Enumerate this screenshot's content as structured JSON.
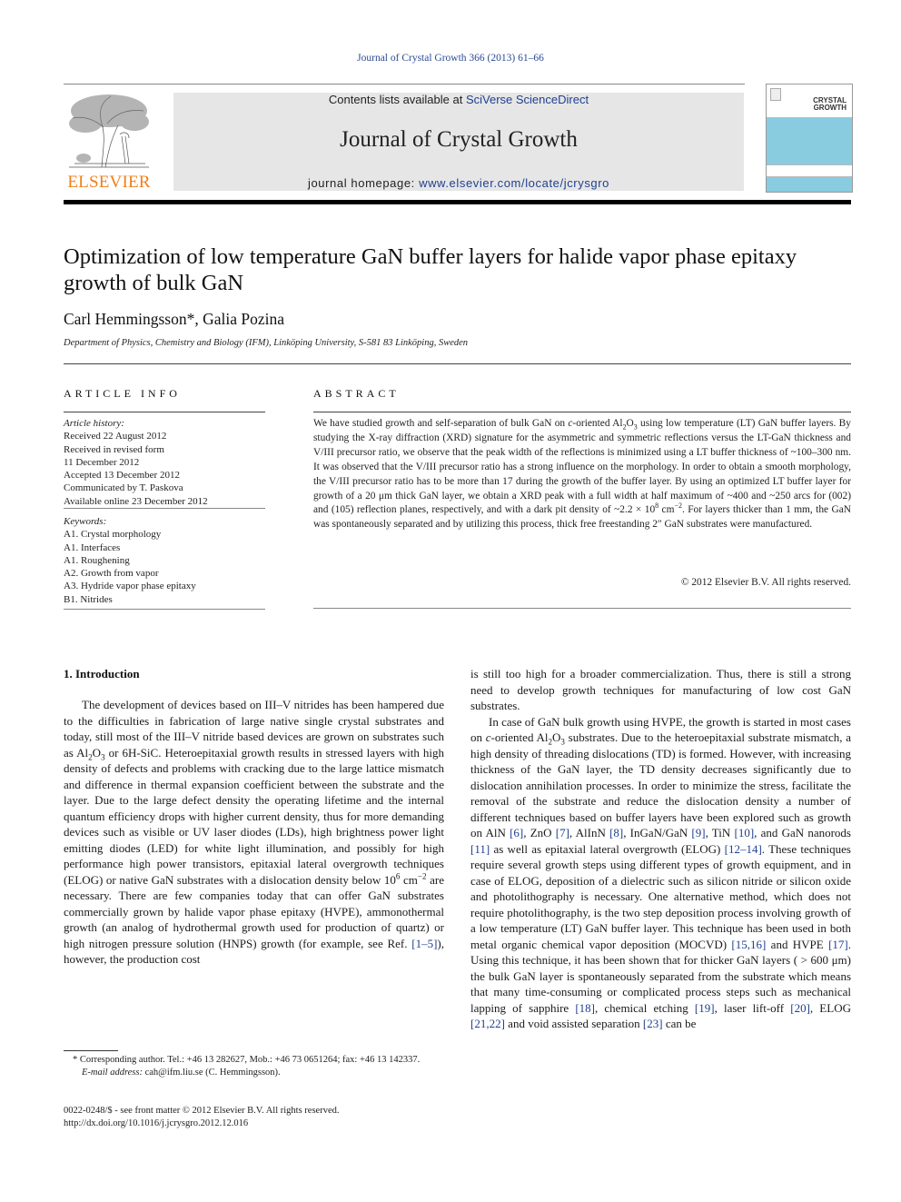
{
  "running_head": "Journal of Crystal Growth 366 (2013) 61–66",
  "header": {
    "publisher_logo_text": "ELSEVIER",
    "contents_prefix": "Contents lists available at ",
    "contents_link": "SciVerse ScienceDirect",
    "journal_name": "Journal of Crystal Growth",
    "homepage_prefix": "journal homepage: ",
    "homepage_link": "www.elsevier.com/locate/jcrysgro",
    "cover_title_line1": "CRYSTAL",
    "cover_title_line2": "GROWTH",
    "colors": {
      "link": "#1f3f8f",
      "elsevier_orange": "#f07f1b",
      "banner_bg": "#e6e6e6",
      "cover_blue": "#89cce0"
    }
  },
  "article": {
    "title": "Optimization of low temperature GaN buffer layers for halide vapor phase epitaxy growth of bulk GaN",
    "authors": "Carl Hemmingsson*, Galia Pozina",
    "affiliation": "Department of Physics, Chemistry and Biology (IFM), Linköping University, S-581 83 Linköping, Sweden"
  },
  "article_info": {
    "heading": "ARTICLE INFO",
    "history_label": "Article history:",
    "history": [
      "Received 22 August 2012",
      "Received in revised form",
      "11 December 2012",
      "Accepted 13 December 2012",
      "Communicated by T. Paskova",
      "Available online 23 December 2012"
    ],
    "keywords_label": "Keywords:",
    "keywords": [
      "A1. Crystal morphology",
      "A1. Interfaces",
      "A1. Roughening",
      "A2. Growth from vapor",
      "A3. Hydride vapor phase epitaxy",
      "B1. Nitrides"
    ]
  },
  "abstract": {
    "heading": "ABSTRACT",
    "p1": "We have studied growth and self-separation of bulk GaN on ",
    "p1_ital": "c",
    "p2": "-oriented Al",
    "sub2": "2",
    "p3": "O",
    "sub3": "3",
    "p4": " using low temperature (LT) GaN buffer layers. By studying the X-ray diffraction (XRD) signature for the asymmetric and symmetric reflections versus the LT-GaN thickness and V/III precursor ratio, we observe that the peak width of the reflections is minimized using a LT buffer thickness of ~100–300 nm. It was observed that the V/III precursor ratio has a strong influence on the morphology. In order to obtain a smooth morphology, the V/III precursor ratio has to be more than 17 during the growth of the buffer layer. By using an optimized LT buffer layer for growth of a 20 μm thick GaN layer, we obtain a XRD peak with a full width at half maximum of ~400 and ~250 arcs for (002) and (105) reflection planes, respectively, and with a dark pit density of ~2.2 × 10",
    "sup8": "8",
    "p5": " cm",
    "supm2": "−2",
    "p6": ". For layers thicker than 1 mm, the GaN was spontaneously separated and by utilizing this process, thick free freestanding 2″ GaN substrates were manufactured.",
    "copyright": "© 2012 Elsevier B.V. All rights reserved."
  },
  "introduction": {
    "heading": "1.  Introduction",
    "left": {
      "a": "The development of devices based on III–V nitrides has been hampered due to the difficulties in fabrication of large native single crystal substrates and today, still most of the III–V nitride based devices are grown on substrates such as Al",
      "b": "O",
      "c": " or 6H-SiC. Heteroepitaxial growth results in stressed layers with high density of defects and problems with cracking due to the large lattice mismatch and difference in thermal expansion coefficient between the substrate and the layer. Due to the large defect density the operating lifetime and the internal quantum efficiency drops with higher current density, thus for more demanding devices such as visible or UV laser diodes (LDs), high brightness power light emitting diodes (LED) for white light illumination, and possibly for high performance high power transistors, epitaxial lateral overgrowth techniques (ELOG) or native GaN substrates with a dislocation density below 10",
      "sup6": "6",
      "d": " cm",
      "supm2": "−2",
      "e": " are necessary. There are few companies today that can offer GaN substrates commercially grown by halide vapor phase epitaxy (HVPE), ammonothermal growth (an analog of hydrothermal growth used for production of quartz) or high nitrogen pressure solution (HNPS) growth (for example, see Ref. ",
      "ref1": "[1–5]",
      "f": "), however, the production cost"
    },
    "right": {
      "p1": "is still too high for a broader commercialization. Thus, there is still a strong need to develop growth techniques for manufacturing of low cost GaN substrates.",
      "p2a": "In case of GaN bulk growth using HVPE, the growth is started in most cases on ",
      "p2ital": "c",
      "p2b": "-oriented Al",
      "p2c": "O",
      "p2d": " substrates. Due to the heteroepitaxial substrate mismatch, a high density of threading dislocations (TD) is formed. However, with increasing thickness of the GaN layer, the TD density decreases significantly due to dislocation annihilation processes. In order to minimize the stress, facilitate the removal of the substrate and reduce the dislocation density a number of different techniques based on buffer layers have been explored such as growth on AlN ",
      "r6": "[6]",
      "t1": ", ZnO ",
      "r7": "[7]",
      "t2": ", AlInN ",
      "r8": "[8]",
      "t3": ", InGaN/GaN ",
      "r9": "[9]",
      "t4": ", TiN ",
      "r10": "[10]",
      "t5": ", and GaN nanorods ",
      "r11": "[11]",
      "t6": " as well as epitaxial lateral overgrowth (ELOG) ",
      "r12": "[12–14]",
      "t7": ". These techniques require several growth steps using different types of growth equipment, and in case of ELOG, deposition of a dielectric such as silicon nitride or silicon oxide and photolithography is necessary. One alternative method, which does not require photolithography, is the two step deposition process involving growth of a low temperature (LT) GaN buffer layer. This technique has been used in both metal organic chemical vapor deposition (MOCVD) ",
      "r15": "[15,16]",
      "t8": " and HVPE ",
      "r17": "[17]",
      "t9": ". Using this technique, it has been shown that for thicker GaN layers ( > 600 μm) the bulk GaN layer is spontaneously separated from the substrate which means that many time-consuming or complicated process steps such as mechanical lapping of sapphire ",
      "r18": "[18]",
      "t10": ", chemical etching ",
      "r19": "[19]",
      "t11": ", laser lift-off ",
      "r20": "[20]",
      "t12": ", ELOG ",
      "r21": "[21,22]",
      "t13": " and void assisted separation ",
      "r23": "[23]",
      "t14": " can be"
    }
  },
  "footnote": {
    "corresponding": "* Corresponding author. Tel.: +46 13 282627, Mob.: +46 73 0651264; fax: +46 13 142337.",
    "email_label": "E-mail address:",
    "email": " cah@ifm.liu.se (C. Hemmingsson)."
  },
  "issn_line": "0022-0248/$ - see front matter © 2012 Elsevier B.V. All rights reserved.",
  "doi_line": "http://dx.doi.org/10.1016/j.jcrysgro.2012.12.016",
  "sub_two": "2",
  "sub_three": "3"
}
